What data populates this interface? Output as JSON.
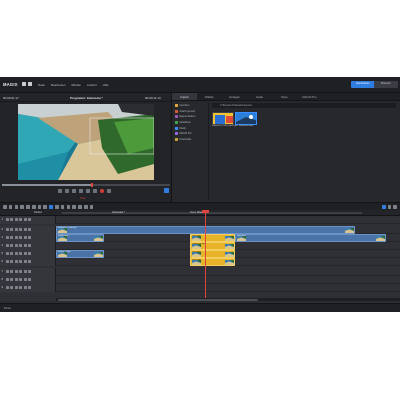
{
  "app": {
    "logo": "MAGIX",
    "menu": [
      "Datei",
      "Bearbeiten",
      "Effekte",
      "Ansicht",
      "Hilfe"
    ],
    "export_label": "Exportieren",
    "render_label": "Brennen"
  },
  "preview": {
    "timecode_left": "00:00:01:17",
    "title": "Programm: Indonesia *",
    "timecode_right": "00:00:11:10",
    "scrub_progress": 0.53,
    "footer": "Stop"
  },
  "media": {
    "tabs": [
      "Import",
      "Effekte",
      "Vorlagen",
      "Audio",
      "Store",
      "MAGIX Pro"
    ],
    "active_tab": 0,
    "tree": [
      {
        "label": "Favoriten",
        "color": "#e0a83c"
      },
      {
        "label": "Zuletzt genutzt",
        "color": "#d45a3c"
      },
      {
        "label": "Eigene Medien",
        "color": "#9b59b6"
      },
      {
        "label": "Mediathek",
        "color": "#3fa34d"
      },
      {
        "label": "Musik",
        "color": "#3a8dff"
      },
      {
        "label": "MAGIX Pro",
        "color": "#8a6be0"
      },
      {
        "label": "Downloads",
        "color": "#c6a23d"
      }
    ],
    "path": "C:\\Benutzer\\Videos\\Indonesia",
    "thumbs": [
      {
        "caption": "Indonesia_Cafe_mp4.mp4",
        "selected": false
      },
      {
        "caption": "Indonesia.mp4",
        "selected": true
      }
    ]
  },
  "ruler": {
    "labels": [
      "Strand",
      "Indonesia *",
      "Insel, Waelder"
    ]
  },
  "tracks": [
    {
      "num": "1",
      "clips": []
    },
    {
      "num": "2",
      "clips": [
        {
          "label": "Indonesia_Cafe.mp4",
          "color": "blue",
          "start": 0.0,
          "end": 0.87
        }
      ]
    },
    {
      "num": "3",
      "clips": [
        {
          "label": "Strand.mp4",
          "color": "blue",
          "start": 0.0,
          "end": 0.14
        },
        {
          "label": "Intro.mp4",
          "color": "yellow",
          "start": 0.39,
          "end": 0.52
        },
        {
          "label": "Wald.mp4",
          "color": "blue",
          "start": 0.52,
          "end": 0.96
        }
      ]
    },
    {
      "num": "4",
      "clips": [
        {
          "label": "Indonesia.mp4",
          "color": "yellow",
          "start": 0.39,
          "end": 0.52
        }
      ]
    },
    {
      "num": "5",
      "clips": [
        {
          "label": "Strand_2.mp4",
          "color": "blue",
          "start": 0.0,
          "end": 0.14
        },
        {
          "label": "Insel.mp4",
          "color": "yellow",
          "start": 0.39,
          "end": 0.52
        }
      ]
    },
    {
      "num": "6",
      "clips": [
        {
          "label": "Pano.mp4",
          "color": "yellow",
          "start": 0.39,
          "end": 0.52
        }
      ]
    },
    {
      "num": "7",
      "clips": []
    },
    {
      "num": "8",
      "clips": []
    },
    {
      "num": "9",
      "clips": []
    }
  ],
  "status": "Bereit",
  "colors": {
    "accent": "#2f7de1",
    "playhead": "#e0443e",
    "clip_blue": "#4a74a8",
    "clip_yellow": "#e7b429"
  }
}
